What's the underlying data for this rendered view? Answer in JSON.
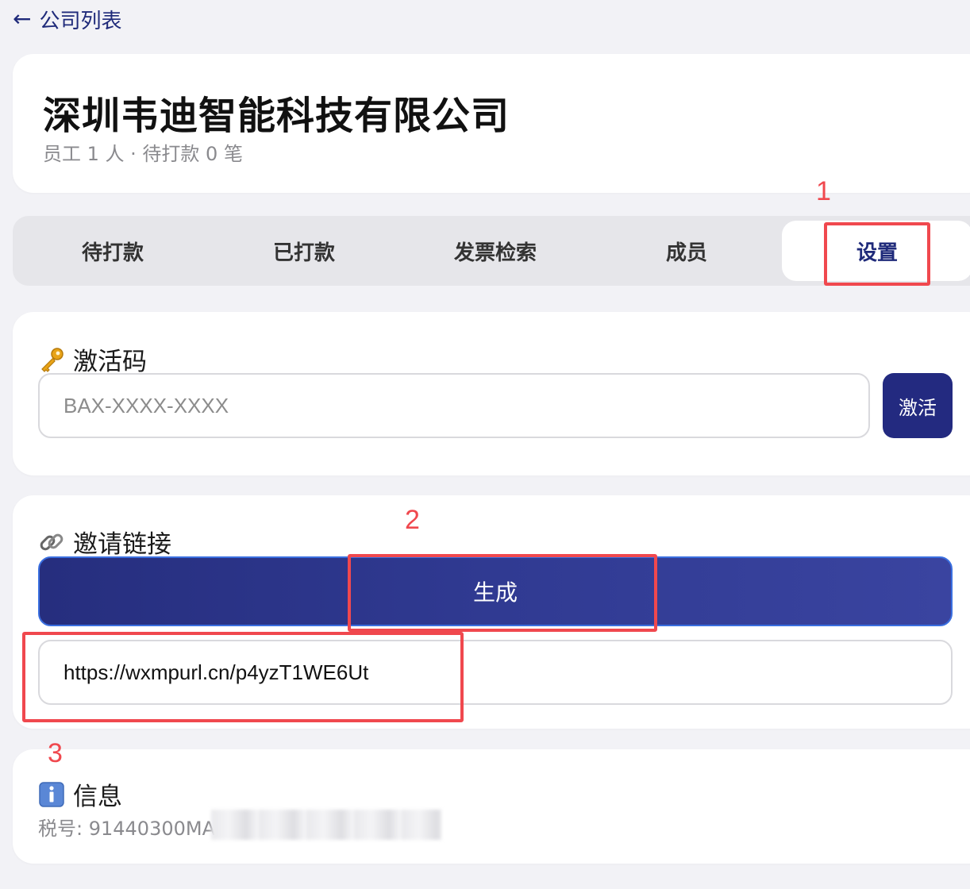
{
  "nav": {
    "back_arrow": "←",
    "back_label": "公司列表"
  },
  "company": {
    "name": "深圳韦迪智能科技有限公司",
    "subtitle": "员工 1 人 · 待打款 0 笔"
  },
  "tabs": [
    {
      "label": "待打款"
    },
    {
      "label": "已打款"
    },
    {
      "label": "发票检索"
    },
    {
      "label": "成员"
    },
    {
      "label": "设置"
    }
  ],
  "active_tab": "设置",
  "activation": {
    "icon": "key-icon",
    "title": "激活码",
    "placeholder": "BAX-XXXX-XXXX",
    "value": "",
    "button_label": "激活"
  },
  "invite": {
    "icon": "link-icon",
    "title": "邀请链接",
    "generate_label": "生成",
    "link_value": "https://wxmpurl.cn/p4yzT1WE6Ut"
  },
  "info": {
    "icon": "info-icon",
    "title": "信息",
    "tax_label": "税号: ",
    "tax_value_visible": "91440300MA"
  },
  "annotations": [
    {
      "label": "1"
    },
    {
      "label": "2"
    },
    {
      "label": "3"
    }
  ],
  "colors": {
    "accent": "#232a80",
    "annotation": "#f0484e",
    "page_bg": "#f2f2f6"
  }
}
